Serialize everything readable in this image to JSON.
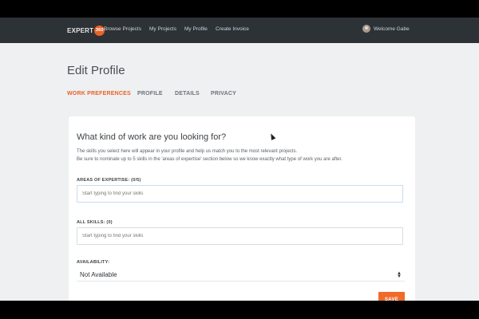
{
  "navbar": {
    "logo_text": "EXPERT",
    "logo_badge": "360",
    "links": [
      {
        "label": "Browse Projects"
      },
      {
        "label": "My Projects"
      },
      {
        "label": "My Profile"
      },
      {
        "label": "Create Invoice"
      }
    ],
    "user_greeting": "Welcome Gabe"
  },
  "page": {
    "title": "Edit Profile",
    "tabs": [
      {
        "label": "WORK PREFERENCES",
        "active": true
      },
      {
        "label": "PROFILE",
        "active": false
      },
      {
        "label": "DETAILS",
        "active": false
      },
      {
        "label": "PRIVACY",
        "active": false
      }
    ]
  },
  "form": {
    "heading": "What kind of work are you looking for?",
    "description_1": "The skills you select here will appear in your profile and help us match you to the most relevant projects.",
    "description_2": "Be sure to nominate up to 5 skills in the 'areas of expertise' section below so we know exactly what type of work you are after.",
    "areas_label": "AREAS OF EXPERTISE: (0/5)",
    "areas_placeholder": "Start typing to find your skills",
    "all_skills_label": "ALL SKILLS: (0)",
    "all_skills_placeholder": "Start typing to find your skills",
    "availability_label": "AVAILABILITY:",
    "availability_value": "Not Available",
    "save_label": "SAVE"
  },
  "colors": {
    "accent": "#e8622a",
    "navbar": "#2d3237",
    "background": "#eef0f1"
  }
}
